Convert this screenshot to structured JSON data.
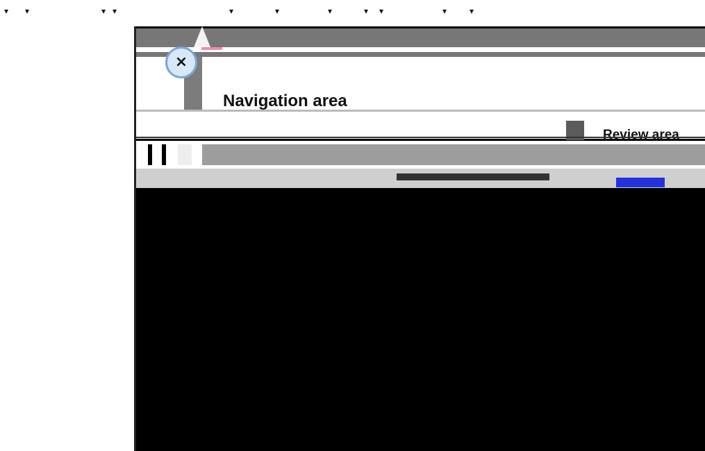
{
  "top_ticks": [
    "▾",
    "▾",
    "▾",
    "▾",
    "▾",
    "▾",
    "▾",
    "▾",
    "▾",
    "▾",
    "▾"
  ],
  "window": {
    "close_icon": "×",
    "navigation_area_label": "Navigation area",
    "review_area_label": "Review area"
  },
  "icons": {
    "close": "close-icon"
  }
}
